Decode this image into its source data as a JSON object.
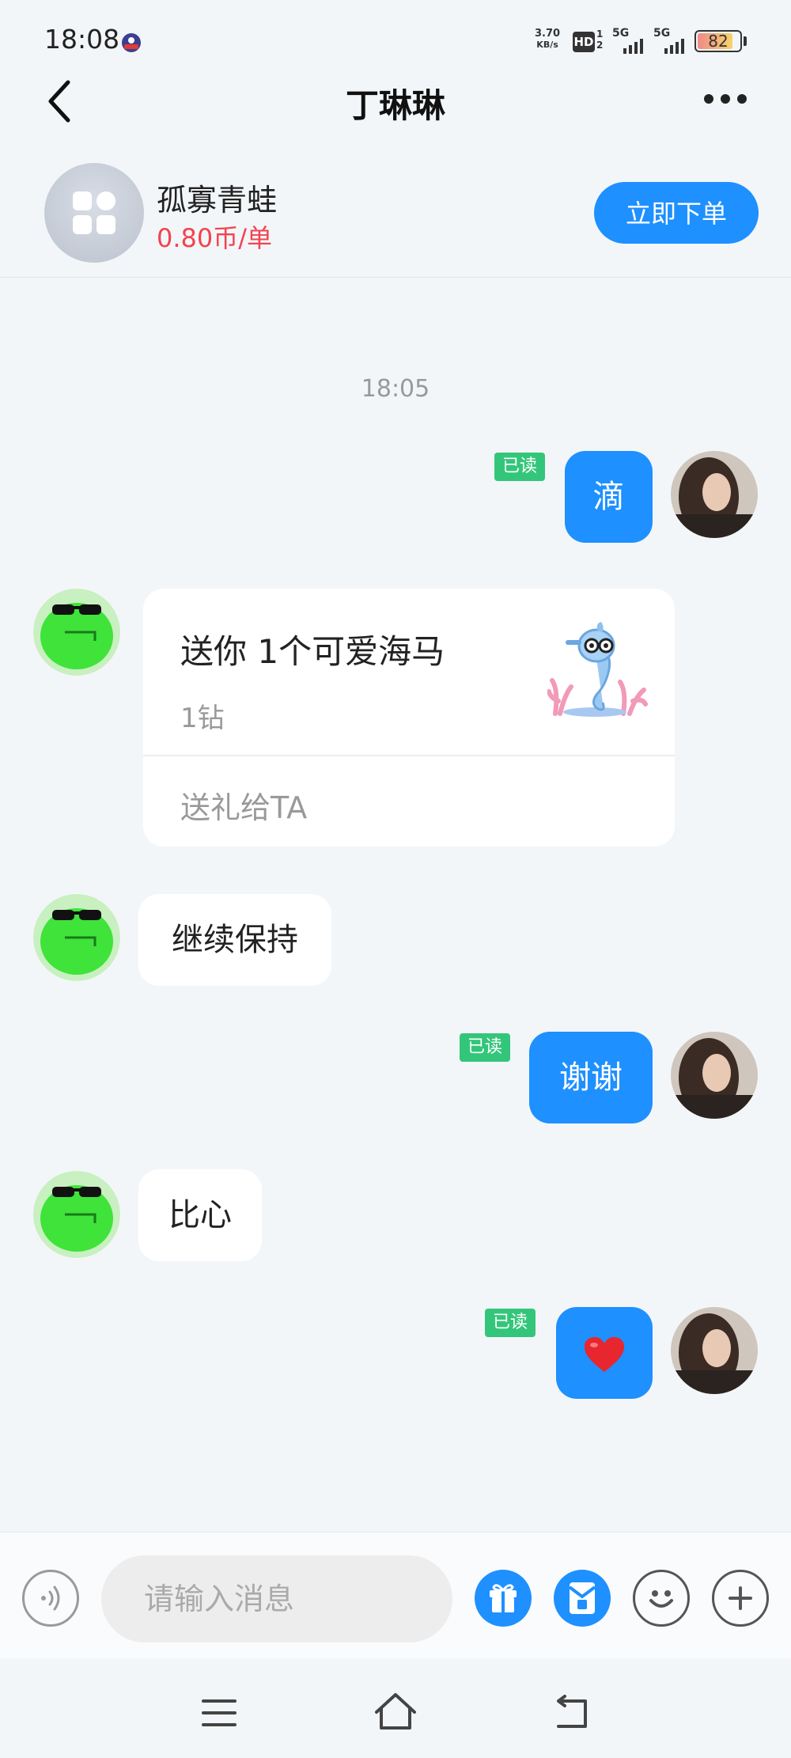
{
  "status_bar": {
    "time": "18:08",
    "net_speed_value": "3.70",
    "net_speed_unit": "KB/s",
    "hd": "HD",
    "sim_numbers": [
      "1",
      "2"
    ],
    "signal_labels": [
      "5G",
      "5G"
    ],
    "battery": "82"
  },
  "header": {
    "title": "丁琳琳"
  },
  "profile": {
    "name": "孤寡青蛙",
    "price": "0.80币/单",
    "order_button": "立即下单"
  },
  "chat": {
    "timestamp": "18:05",
    "read_label": "已读",
    "messages": [
      {
        "side": "right",
        "text": "滴",
        "read": true
      },
      {
        "side": "left",
        "type": "gift",
        "gift_title": "送你 1个可爱海马",
        "gift_price": "1钻",
        "gift_action": "送礼给TA"
      },
      {
        "side": "left",
        "text": "继续保持"
      },
      {
        "side": "right",
        "text": "谢谢",
        "read": true
      },
      {
        "side": "left",
        "text": "比心"
      },
      {
        "side": "right",
        "text": "❤️",
        "read": true
      }
    ]
  },
  "input_bar": {
    "placeholder": "请输入消息"
  },
  "colors": {
    "accent": "#1e90ff",
    "read_badge": "#33c67a",
    "price": "#f2444f",
    "background": "#f3f6f9"
  },
  "icons": {
    "back": "back-arrow-icon",
    "more": "more-dots-icon",
    "voice": "voice-icon",
    "gift": "gift-icon",
    "red_packet": "red-packet-icon",
    "emoji": "emoji-icon",
    "plus": "plus-icon",
    "nav_menu": "menu-icon",
    "nav_home": "home-icon",
    "nav_back": "nav-back-icon"
  }
}
